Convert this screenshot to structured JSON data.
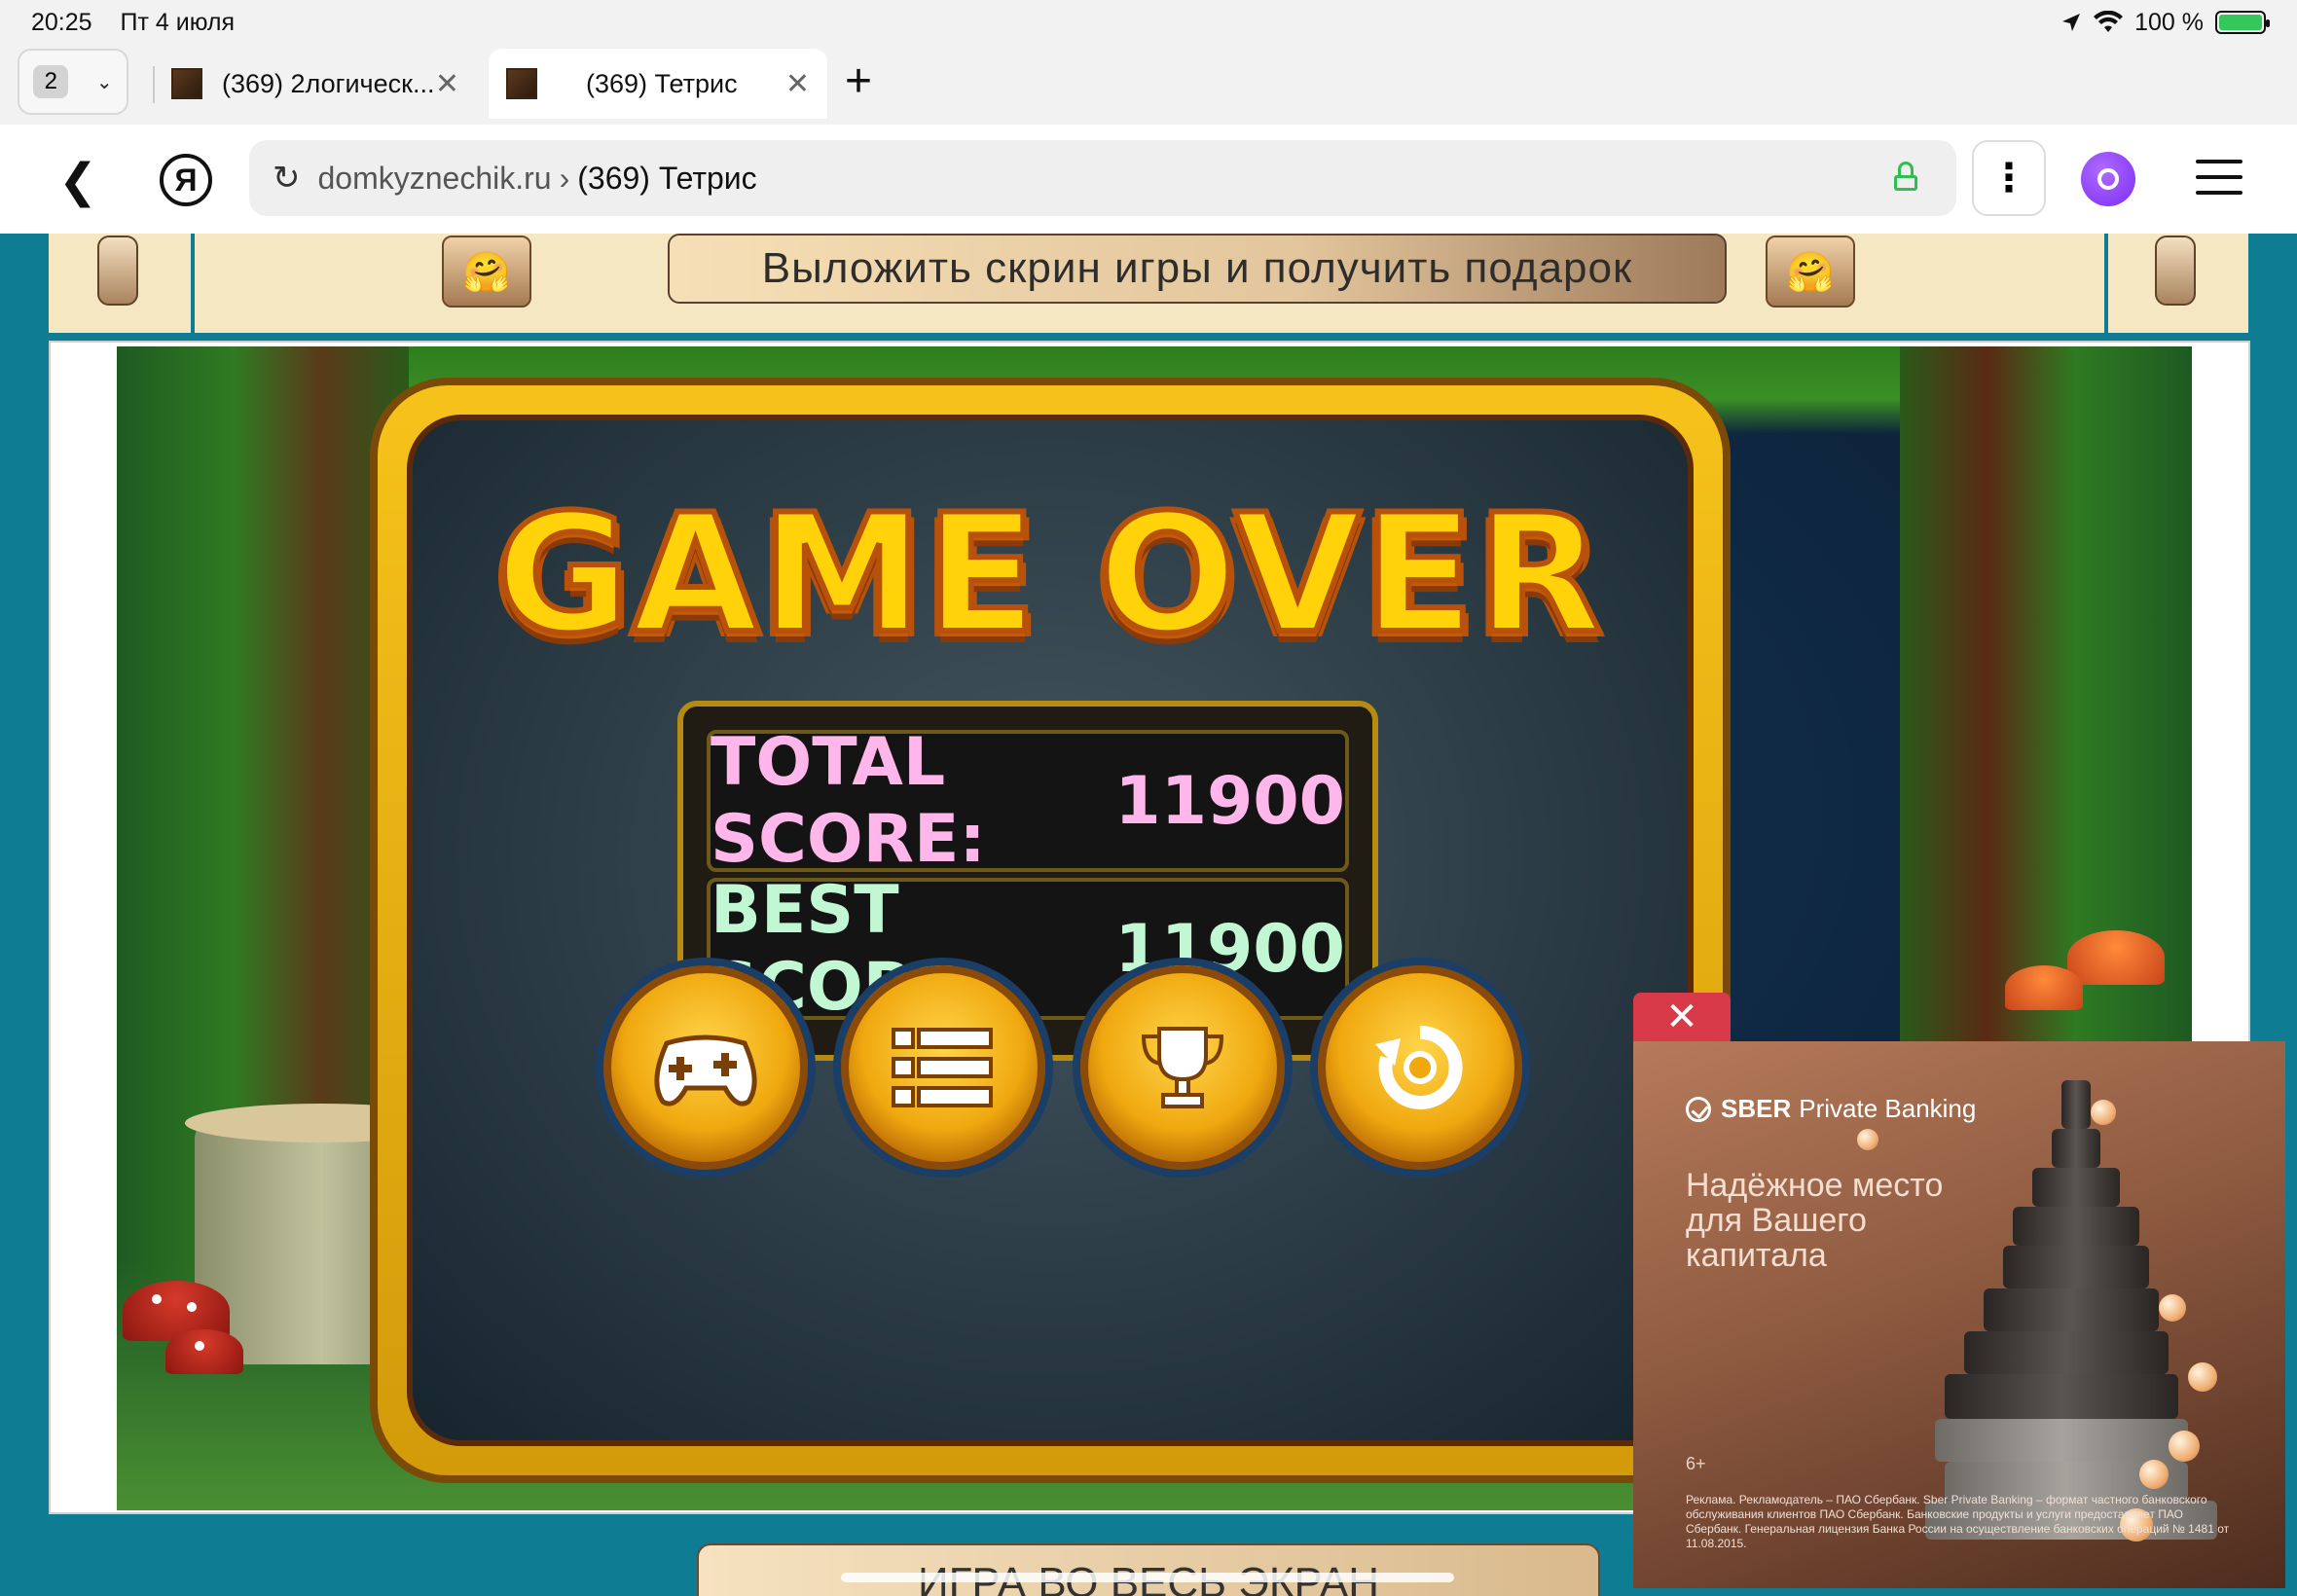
{
  "status_bar": {
    "time": "20:25",
    "date": "Пт 4 июля",
    "battery_percent": "100 %",
    "battery_level": 1.0
  },
  "tabs": {
    "count": "2",
    "items": [
      {
        "title": "(369) 2логическ...",
        "active": false
      },
      {
        "title": "(369) Тетрис",
        "active": true
      }
    ]
  },
  "address_bar": {
    "host": "domkyznechik.ru",
    "separator": "›",
    "page_title": "(369) Тетрис"
  },
  "banner": {
    "gift_label": "Выложить скрин игры и получить подарок",
    "emoji_left": "🤗",
    "emoji_right": "🤗"
  },
  "game": {
    "title": "GAME OVER",
    "total_score_label": "TOTAL SCORE:",
    "total_score": "11900",
    "best_score_label": "BEST SCORE:",
    "best_score": "11900",
    "buttons": [
      "gamepad-icon",
      "list-icon",
      "trophy-icon",
      "restart-icon"
    ],
    "fullscreen_label": "ИГРА ВО ВЕСЬ ЭКРАН"
  },
  "ad": {
    "close_label": "✕",
    "brand_bold": "SBER",
    "brand_rest": "Private Banking",
    "headline": "Надёжное место для Вашего капитала",
    "age_rating": "6+",
    "legal": "Реклама. Рекламодатель – ПАО Сбербанк. Sber Private Banking – формат частного банковского обслуживания клиентов ПАО Сбербанк. Банковские продукты и услуги предоставляет ПАО Сбербанк. Генеральная лицензия Банка России на осуществление банковских операций № 1481 от 11.08.2015."
  },
  "colors": {
    "page_bg": "#0e7d93",
    "ad_close": "#d83a4a",
    "total_score": "#ffb6ea",
    "best_score": "#c2f7d4",
    "alice": "#7a2cf5"
  }
}
